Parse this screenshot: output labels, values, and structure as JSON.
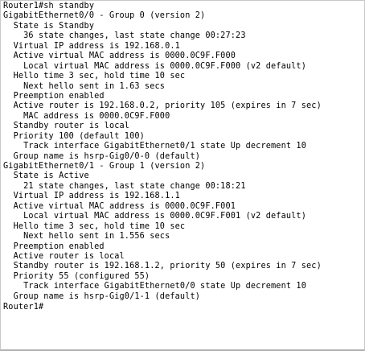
{
  "terminal": {
    "lines": [
      "Router1#sh standby",
      "GigabitEthernet0/0 - Group 0 (version 2)",
      "  State is Standby",
      "    36 state changes, last state change 00:27:23",
      "  Virtual IP address is 192.168.0.1",
      "  Active virtual MAC address is 0000.0C9F.F000",
      "    Local virtual MAC address is 0000.0C9F.F000 (v2 default)",
      "  Hello time 3 sec, hold time 10 sec",
      "    Next hello sent in 1.63 secs",
      "  Preemption enabled",
      "  Active router is 192.168.0.2, priority 105 (expires in 7 sec)",
      "    MAC address is 0000.0C9F.F000",
      "  Standby router is local",
      "  Priority 100 (default 100)",
      "    Track interface GigabitEthernet0/1 state Up decrement 10",
      "  Group name is hsrp-Gig0/0-0 (default)",
      "GigabitEthernet0/1 - Group 1 (version 2)",
      "  State is Active",
      "    21 state changes, last state change 00:18:21",
      "  Virtual IP address is 192.168.1.1",
      "  Active virtual MAC address is 0000.0C9F.F001",
      "    Local virtual MAC address is 0000.0C9F.F001 (v2 default)",
      "  Hello time 3 sec, hold time 10 sec",
      "    Next hello sent in 1.556 secs",
      "  Preemption enabled",
      "  Active router is local",
      "  Standby router is 192.168.1.2, priority 50 (expires in 7 sec)",
      "  Priority 55 (configured 55)",
      "    Track interface GigabitEthernet0/0 state Up decrement 10",
      "  Group name is hsrp-Gig0/1-1 (default)"
    ],
    "prompt": "Router1#"
  }
}
